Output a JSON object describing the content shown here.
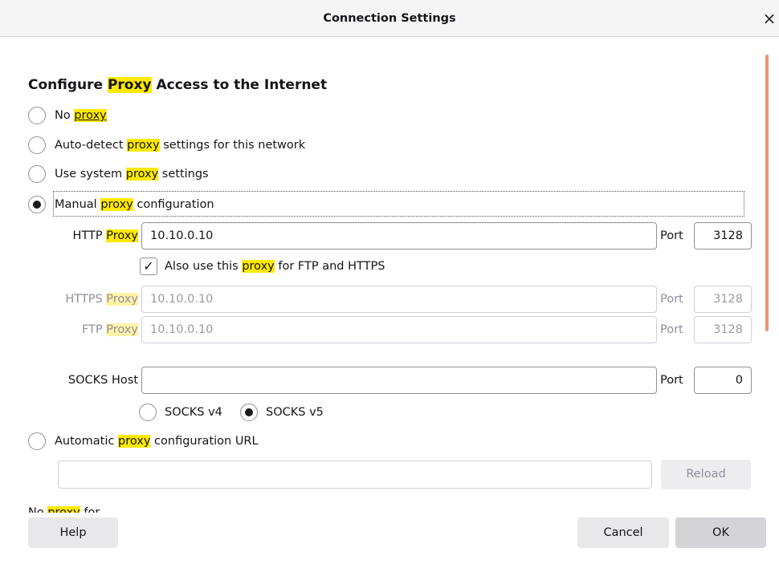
{
  "window": {
    "title": "Connection Settings",
    "close_glyph": "×"
  },
  "heading": {
    "pre": "Configure ",
    "hl": "Proxy",
    "post": " Access to the Internet"
  },
  "radios": {
    "no_proxy": {
      "pre": "No ",
      "hl": "proxy",
      "post": "",
      "checked": false
    },
    "auto_detect": {
      "pre": "Auto-detect ",
      "hl": "proxy",
      "post": " settings for this network",
      "checked": false
    },
    "system": {
      "pre": "Use system ",
      "hl": "proxy",
      "post": " settings",
      "checked": false
    },
    "manual": {
      "pre": "Manual ",
      "hl": "proxy",
      "post": " configuration",
      "checked": true
    },
    "auto_url": {
      "pre": "Automatic ",
      "hl": "proxy",
      "post": " configuration URL",
      "checked": false
    }
  },
  "http": {
    "label_pre": "HTTP ",
    "label_hl": "Proxy",
    "value": "10.10.0.10",
    "port_label": "Port",
    "port": "3128"
  },
  "also_use": {
    "checked_glyph": "✓",
    "pre": "Also use this ",
    "hl": "proxy",
    "post": " for FTP and HTTPS"
  },
  "https": {
    "label_pre": "HTTPS ",
    "label_hl": "Proxy",
    "value": "10.10.0.10",
    "port_label": "Port",
    "port": "3128"
  },
  "ftp": {
    "label_pre": "FTP ",
    "label_hl": "Proxy",
    "value": "10.10.0.10",
    "port_label": "Port",
    "port": "3128"
  },
  "socks": {
    "label": "SOCKS Host",
    "value": "",
    "port_label": "Port",
    "port": "0",
    "v4_label": "SOCKS v4",
    "v5_label": "SOCKS v5",
    "selected": "v5"
  },
  "auto_url_field": {
    "value": ""
  },
  "reload_button": "Reload",
  "no_proxy_for": {
    "pre": "No ",
    "hl": "proxy",
    "post": " for"
  },
  "footer": {
    "help": "Help",
    "cancel": "Cancel",
    "ok": "OK"
  },
  "colors": {
    "highlight": "#ffe900",
    "scrollbar": "#e8967a"
  }
}
